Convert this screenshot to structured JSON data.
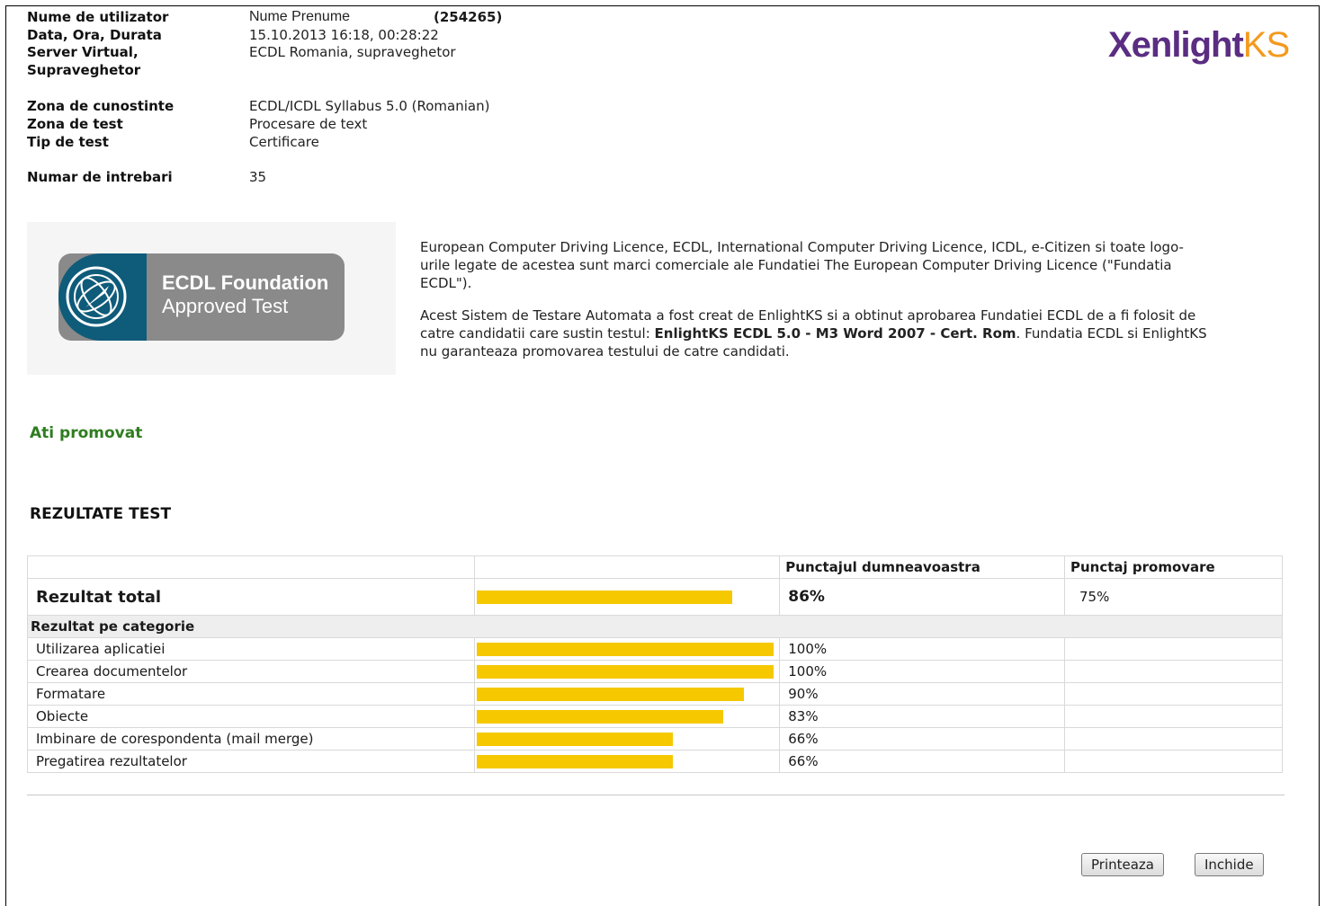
{
  "header": {
    "user_label": "Nume de utilizator",
    "user_value": "Nume Prenume",
    "user_id": "(254265)",
    "date_label": "Data, Ora, Durata",
    "date_value": "15.10.2013 16:18, 00:28:22",
    "server_label_1": "Server Virtual,",
    "server_label_2": "Supraveghetor",
    "server_value": "ECDL Romania, supraveghetor",
    "zone_label": "Zona de cunostinte",
    "zone_value": "ECDL/ICDL Syllabus 5.0 (Romanian)",
    "test_zone_label": "Zona de test",
    "test_zone_value": "Procesare de text",
    "test_type_label": "Tip de test",
    "test_type_value": "Certificare",
    "questions_label": "Numar de intrebari",
    "questions_value": "35"
  },
  "logo": {
    "brand_main": "Xenlight",
    "brand_suffix": "KS"
  },
  "ecdl_badge": {
    "line1": "ECDL Foundation",
    "line2": "Approved Test"
  },
  "legal": {
    "p1": "European Computer Driving Licence, ECDL, International Computer Driving Licence, ICDL, e-Citizen si toate logo-urile legate de acestea sunt marci comerciale ale Fundatiei The European Computer Driving Licence (\"Fundatia ECDL\").",
    "p2_start": "Acest Sistem de Testare Automata a fost creat de EnlightKS si a obtinut aprobarea Fundatiei ECDL de a fi folosit de catre candidatii care sustin testul: ",
    "p2_bold": "EnlightKS ECDL 5.0 - M3 Word 2007 - Cert. Rom",
    "p2_end": ". Fundatia ECDL si EnlightKS nu garanteaza promovarea testului de catre candidati."
  },
  "status": "Ati promovat",
  "results": {
    "title": "REZULTATE TEST",
    "col_score": "Punctajul dumneavoastra",
    "col_pass": "Punctaj promovare",
    "total_label": "Rezultat total",
    "total_score": "86%",
    "total_value": 86,
    "pass_score": "75%",
    "category_header": "Rezultat pe categorie",
    "categories": [
      {
        "label": "Utilizarea aplicatiei",
        "score": "100%",
        "value": 100
      },
      {
        "label": "Crearea documentelor",
        "score": "100%",
        "value": 100
      },
      {
        "label": "Formatare",
        "score": "90%",
        "value": 90
      },
      {
        "label": "Obiecte",
        "score": "83%",
        "value": 83
      },
      {
        "label": "Imbinare de corespondenta (mail merge)",
        "score": "66%",
        "value": 66
      },
      {
        "label": "Pregatirea rezultatelor",
        "score": "66%",
        "value": 66
      }
    ]
  },
  "buttons": {
    "print": "Printeaza",
    "close": "Inchide"
  },
  "colors": {
    "bar": "#f5c800",
    "pass_text": "#2e7d1f",
    "brand_purple": "#5a2d82",
    "brand_orange": "#f39a1e"
  }
}
